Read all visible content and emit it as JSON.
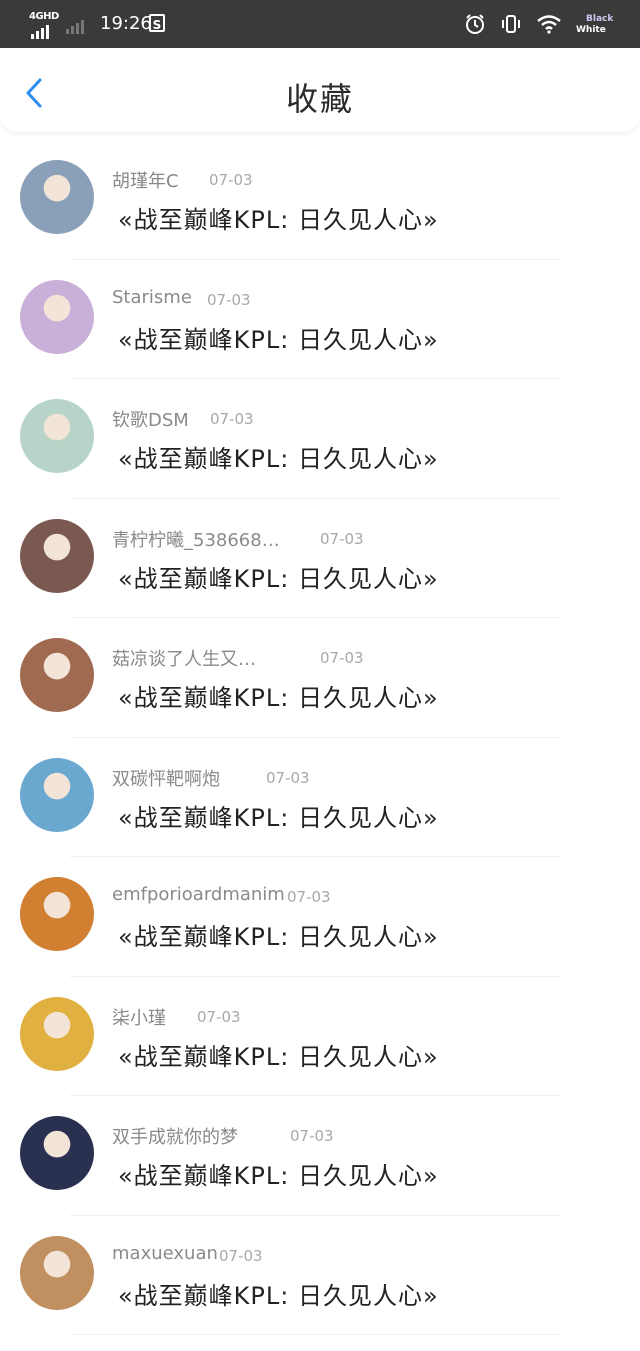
{
  "status_bar": {
    "network": "4GHD",
    "time": "19:26",
    "app_badge": "S",
    "badge_black": "Black",
    "badge_white": "White"
  },
  "header": {
    "title": "收藏"
  },
  "favorites": [
    {
      "user": "胡瑾年C",
      "date": "07-03",
      "title": "«战至巅峰KPL: 日久见人心»",
      "avatar_color": "#8aa0b8"
    },
    {
      "user": "Starisme",
      "date": "07-03",
      "title": "«战至巅峰KPL: 日久见人心»",
      "avatar_color": "#c9b0d8"
    },
    {
      "user": "钦歌DSM",
      "date": "07-03",
      "title": "«战至巅峰KPL: 日久见人心»",
      "avatar_color": "#b8d4c8"
    },
    {
      "user": "青柠柠曦_538668…",
      "date": "07-03",
      "title": "«战至巅峰KPL: 日久见人心»",
      "avatar_color": "#7a5a50"
    },
    {
      "user": "菇凉谈了人生又…",
      "date": "07-03",
      "title": "«战至巅峰KPL: 日久见人心»",
      "avatar_color": "#a06a50"
    },
    {
      "user": "双碳怦靶啊炮",
      "date": "07-03",
      "title": "«战至巅峰KPL: 日久见人心»",
      "avatar_color": "#6aa8d0"
    },
    {
      "user": "emfporioardmanim",
      "date": "07-03",
      "title": "«战至巅峰KPL: 日久见人心»",
      "avatar_color": "#d08030"
    },
    {
      "user": "柒小瑾",
      "date": "07-03",
      "title": "«战至巅峰KPL: 日久见人心»",
      "avatar_color": "#e0b040"
    },
    {
      "user": "双手成就你的梦",
      "date": "07-03",
      "title": "«战至巅峰KPL: 日久见人心»",
      "avatar_color": "#2a3050"
    },
    {
      "user": "maxuexuan",
      "date": "07-03",
      "title": "«战至巅峰KPL: 日久见人心»",
      "avatar_color": "#c09060"
    }
  ],
  "colors": {
    "accent": "#2d8cf0",
    "status_bar": "#3a3a3a"
  }
}
